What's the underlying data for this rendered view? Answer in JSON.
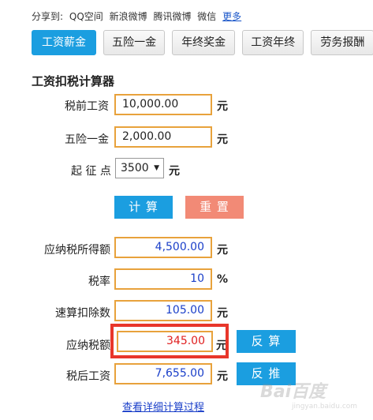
{
  "share": {
    "label": "分享到:",
    "items": [
      "QQ空间",
      "新浪微博",
      "腾讯微博",
      "微信"
    ],
    "more": "更多"
  },
  "tabs": [
    {
      "label": "工资薪金",
      "active": true
    },
    {
      "label": "五险一金",
      "active": false
    },
    {
      "label": "年终奖金",
      "active": false
    },
    {
      "label": "工资年终",
      "active": false
    },
    {
      "label": "劳务报酬",
      "active": false
    }
  ],
  "calculator": {
    "title": "工资扣税计算器",
    "pretax_label": "税前工资",
    "pretax_value": "10,000.00",
    "insurance_label": "五险一金",
    "insurance_value": "2,000.00",
    "threshold_label": "起 征 点",
    "threshold_value": "3500",
    "unit_yuan": "元",
    "unit_percent": "%",
    "calc_button": "计 算",
    "reset_button": "重 置"
  },
  "results": {
    "taxable_label": "应纳税所得额",
    "taxable_value": "4,500.00",
    "rate_label": "税率",
    "rate_value": "10",
    "deduction_label": "速算扣除数",
    "deduction_value": "105.00",
    "tax_label": "应纳税额",
    "tax_value": "345.00",
    "aftertax_label": "税后工资",
    "aftertax_value": "7,655.00",
    "reverse_calc_button": "反 算",
    "reverse_push_button": "反 推",
    "detail_link": "查看详细计算过程"
  },
  "watermark": {
    "text": "Bai百度",
    "sub": "jingyan.baidu.com"
  },
  "colors": {
    "accent": "#1b9ee0",
    "reset": "#f28a76",
    "input_border": "#e8a23c",
    "highlight": "#e8362a",
    "result_text": "#1a3fc9"
  }
}
